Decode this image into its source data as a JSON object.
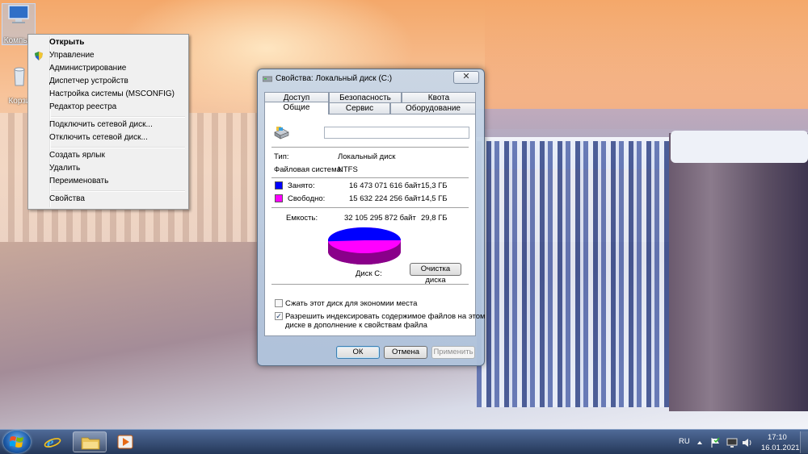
{
  "desktop": {
    "icons": [
      {
        "label": "Компью",
        "selected": true
      },
      {
        "label": "Корзи",
        "selected": false
      }
    ]
  },
  "context_menu": {
    "items": [
      {
        "label": "Открыть",
        "bold": true
      },
      {
        "label": "Управление",
        "icon": "uac-shield-icon"
      },
      {
        "label": "Администрирование"
      },
      {
        "label": "Диспетчер устройств"
      },
      {
        "label": "Настройка системы (MSCONFIG)"
      },
      {
        "label": "Редактор реестра"
      },
      {
        "label": "Подключить сетевой диск..."
      },
      {
        "label": "Отключить сетевой диск..."
      },
      {
        "label": "Создать ярлык"
      },
      {
        "label": "Удалить"
      },
      {
        "label": "Переименовать"
      },
      {
        "label": "Свойства"
      }
    ]
  },
  "dialog": {
    "title": "Свойства: Локальный диск (C:)",
    "close_label": "✕",
    "tabs_row1": [
      "Доступ",
      "Безопасность",
      "Квота"
    ],
    "tabs_row2": [
      "Общие",
      "Сервис",
      "Оборудование"
    ],
    "active_tab": "Общие",
    "drive_name_value": "",
    "type_label": "Тип:",
    "type_value": "Локальный диск",
    "fs_label": "Файловая система:",
    "fs_value": "NTFS",
    "used_label": "Занято:",
    "used_bytes": "16 473 071 616 байт",
    "used_size": "15,3 ГБ",
    "free_label": "Свободно:",
    "free_bytes": "15 632 224 256 байт",
    "free_size": "14,5 ГБ",
    "capacity_label": "Емкость:",
    "capacity_bytes": "32 105 295 872 байт",
    "capacity_size": "29,8 ГБ",
    "disk_label": "Диск C:",
    "cleanup_button": "Очистка диска",
    "compress_label": "Сжать этот диск для экономии места",
    "compress_checked": false,
    "index_label_line1": "Разрешить индексировать содержимое файлов на этом",
    "index_label_line2": "диске в дополнение к свойствам файла",
    "index_checked": true,
    "ok_button": "ОК",
    "cancel_button": "Отмена",
    "apply_button": "Применить",
    "colors": {
      "used": "#0000ff",
      "free": "#ff00ff"
    },
    "used_fraction": 0.513
  },
  "taskbar": {
    "language": "RU",
    "time": "17:10",
    "date": "16.01.2021",
    "pinned": [
      "start-orb",
      "internet-explorer-icon",
      "explorer-icon",
      "media-player-icon"
    ]
  }
}
